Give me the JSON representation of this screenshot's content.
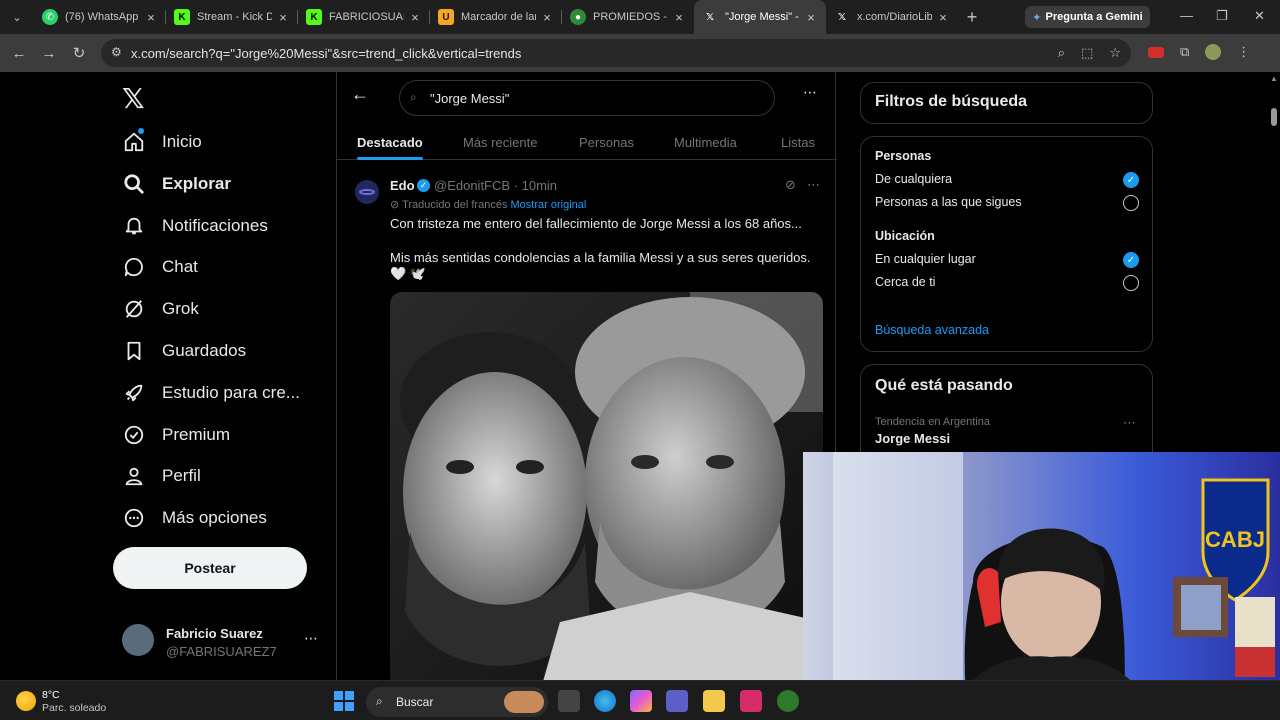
{
  "browser": {
    "tabs": [
      {
        "title": "(76) WhatsApp",
        "icon": "whatsapp-icon"
      },
      {
        "title": "Stream - Kick Da",
        "icon": "kick-icon"
      },
      {
        "title": "FABRICIOSUARE",
        "icon": "kick-icon"
      },
      {
        "title": "Marcador de lar",
        "icon": "u-icon"
      },
      {
        "title": "PROMIEDOS - F",
        "icon": "promiedos-icon"
      },
      {
        "title": "\"Jorge Messi\" - X",
        "icon": "x-icon",
        "active": true
      },
      {
        "title": "x.com/DiarioLib",
        "icon": "x-icon"
      }
    ],
    "gemini_label": "Pregunta a Gemini",
    "url": "x.com/search?q=\"Jorge%20Messi\"&src=trend_click&vertical=trends"
  },
  "sidebar": {
    "items": [
      {
        "label": "Inicio",
        "icon": "home-icon"
      },
      {
        "label": "Explorar",
        "icon": "search-icon",
        "bold": true
      },
      {
        "label": "Notificaciones",
        "icon": "bell-icon"
      },
      {
        "label": "Chat",
        "icon": "chat-icon"
      },
      {
        "label": "Grok",
        "icon": "grok-icon"
      },
      {
        "label": "Guardados",
        "icon": "bookmark-icon"
      },
      {
        "label": "Estudio para cre...",
        "icon": "rocket-icon"
      },
      {
        "label": "Premium",
        "icon": "verified-badge-icon"
      },
      {
        "label": "Perfil",
        "icon": "person-icon"
      },
      {
        "label": "Más opciones",
        "icon": "more-circle-icon"
      }
    ],
    "post_label": "Postear",
    "profile": {
      "name": "Fabricio Suarez",
      "handle": "@FABRISUAREZ7"
    }
  },
  "search": {
    "query": "\"Jorge Messi\"",
    "tabs": [
      "Destacado",
      "Más reciente",
      "Personas",
      "Multimedia",
      "Listas"
    ],
    "active_tab": "Destacado"
  },
  "tweet": {
    "name": "Edo",
    "handle_time": "@EdonitFCB · 10min",
    "translated_label": "Traducido del francés",
    "show_original": "Mostrar original",
    "text1": "Con tristeza me entero del fallecimiento de Jorge Messi a los 68 años...",
    "text2": "Mis más sentidas condolencias a la familia Messi y a sus seres queridos. 🤍 🕊️"
  },
  "filters": {
    "title": "Filtros de búsqueda",
    "people_heading": "Personas",
    "people_options": [
      "De cualquiera",
      "Personas a las que sigues"
    ],
    "people_selected": 0,
    "location_heading": "Ubicación",
    "location_options": [
      "En cualquier lugar",
      "Cerca de ti"
    ],
    "location_selected": 0,
    "advanced_link": "Búsqueda avanzada"
  },
  "trends": {
    "title": "Qué está pasando",
    "items": [
      {
        "meta": "Tendencia en Argentina",
        "name": "Jorge Messi"
      }
    ]
  },
  "taskbar": {
    "weather_temp": "8°C",
    "weather_desc": "Parc. soleado",
    "search_placeholder": "Buscar"
  }
}
